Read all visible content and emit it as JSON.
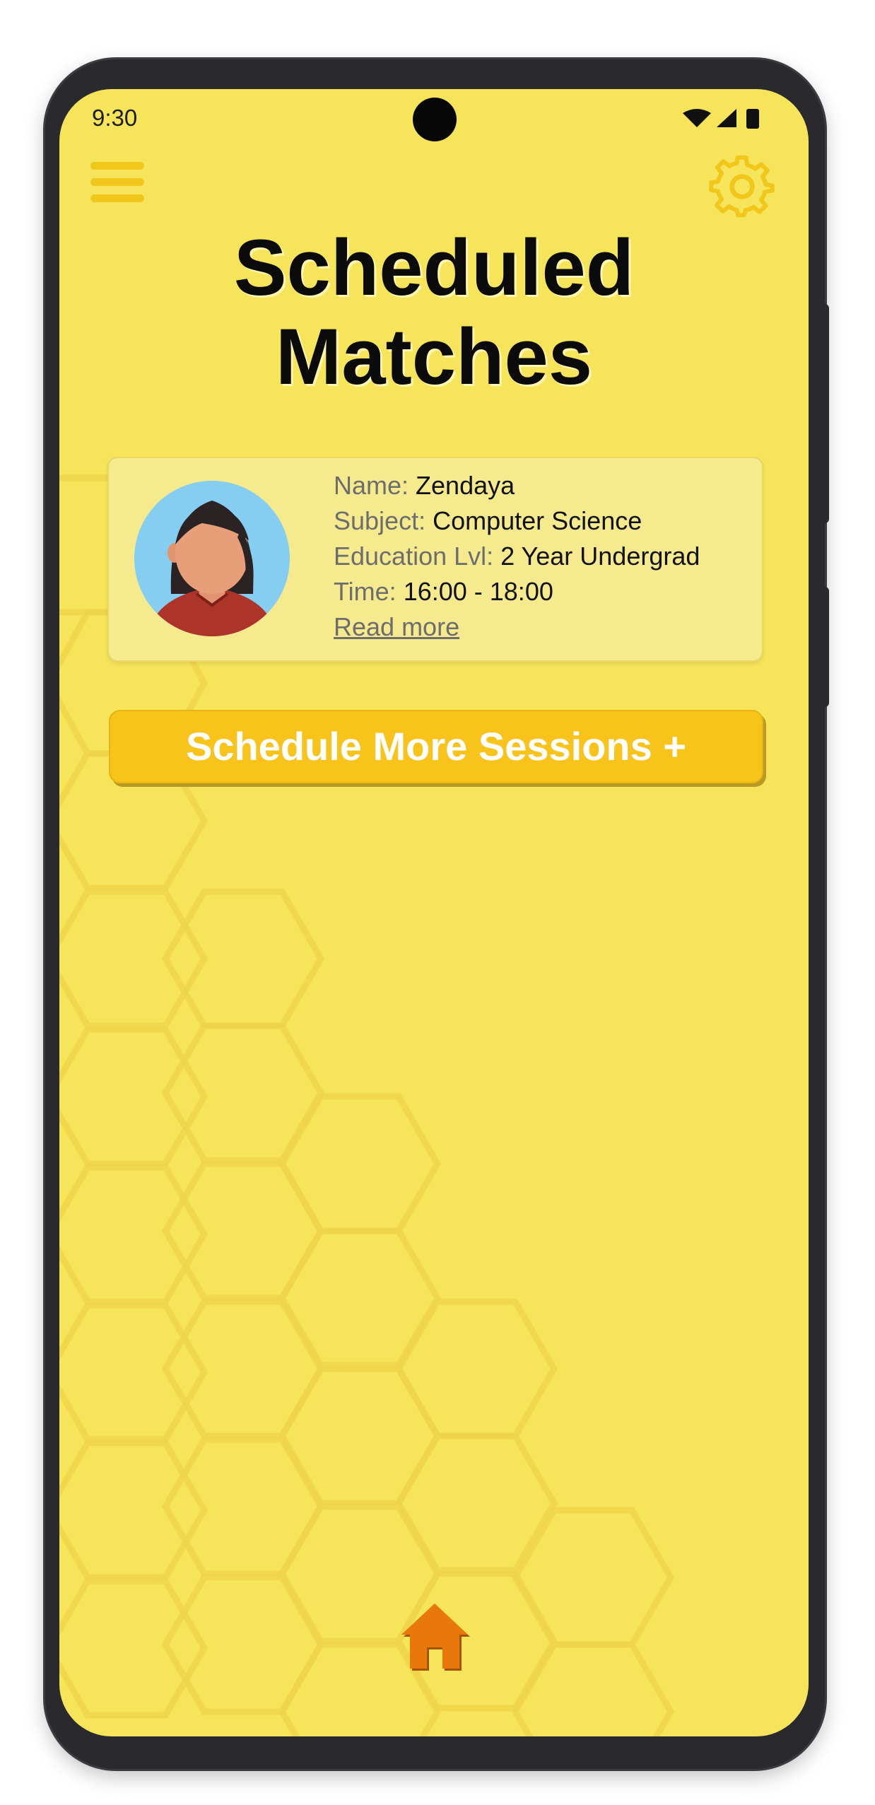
{
  "status_bar": {
    "time": "9:30",
    "icons": [
      "wifi-icon",
      "signal-icon",
      "battery-icon"
    ]
  },
  "header": {
    "menu_icon": "hamburger-menu-icon",
    "settings_icon": "gear-icon"
  },
  "page": {
    "title_line1": "Scheduled",
    "title_line2": "Matches"
  },
  "match_card": {
    "avatar": "person-avatar",
    "name_label": "Name:",
    "name_value": "Zendaya",
    "subject_label": "Subject:",
    "subject_value": "Computer Science",
    "education_label": "Education Lvl:",
    "education_value": "2 Year Undergrad",
    "time_label": "Time:",
    "time_value": "16:00 - 18:00",
    "read_more": "Read more"
  },
  "schedule_button": {
    "label": "Schedule More Sessions +"
  },
  "bottom_nav": {
    "home_icon": "home-icon"
  },
  "colors": {
    "background": "#f6e45a",
    "accent": "#f8c31b",
    "home": "#e8780b",
    "card": "#f6ea8e"
  }
}
